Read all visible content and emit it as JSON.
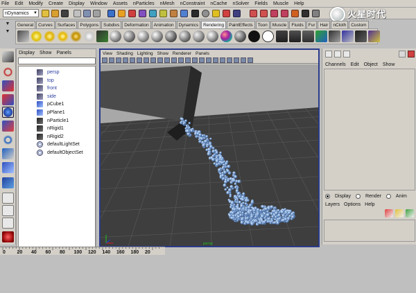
{
  "menus": [
    "File",
    "Edit",
    "Modify",
    "Create",
    "Display",
    "Window",
    "Assets",
    "nParticles",
    "nMesh",
    "nConstraint",
    "nCache",
    "nSolver",
    "Fields",
    "Muscle",
    "Help"
  ],
  "mode_select": "nDynamics",
  "shelf_tabs": [
    "General",
    "Curves",
    "Surfaces",
    "Polygons",
    "Subdivs",
    "Deformation",
    "Animation",
    "Dynamics",
    "Rendering",
    "PaintEffects",
    "Toon",
    "Muscle",
    "Fluids",
    "Fur",
    "Hair",
    "nCloth",
    "Custom"
  ],
  "active_shelf_tab": "Rendering",
  "outliner": {
    "menu": [
      "Display",
      "Show",
      "Panels"
    ],
    "items": [
      {
        "label": "persp",
        "icon": "camera-icon",
        "type": "camera"
      },
      {
        "label": "top",
        "icon": "camera-icon",
        "type": "camera"
      },
      {
        "label": "front",
        "icon": "camera-icon",
        "type": "camera"
      },
      {
        "label": "side",
        "icon": "camera-icon",
        "type": "camera"
      },
      {
        "label": "pCube1",
        "icon": "polygon-icon",
        "type": "mesh"
      },
      {
        "label": "pPlane1",
        "icon": "polygon-icon",
        "type": "mesh"
      },
      {
        "label": "nParticle1",
        "icon": "particle-icon",
        "type": "node"
      },
      {
        "label": "nRigid1",
        "icon": "rigid-icon",
        "type": "node"
      },
      {
        "label": "nRigid2",
        "icon": "rigid-icon",
        "type": "node"
      },
      {
        "label": "defaultLightSet",
        "icon": "set-icon",
        "type": "set"
      },
      {
        "label": "defaultObjectSet",
        "icon": "set-icon",
        "type": "set"
      }
    ]
  },
  "viewport": {
    "menu": [
      "View",
      "Shading",
      "Lighting",
      "Show",
      "Renderer",
      "Panels"
    ],
    "camera_label": "persp"
  },
  "channel_box": {
    "menu": [
      "Channels",
      "Edit",
      "Object",
      "Show"
    ]
  },
  "layer_editor": {
    "radio": [
      {
        "label": "Display",
        "selected": true
      },
      {
        "label": "Render",
        "selected": false
      },
      {
        "label": "Anim",
        "selected": false
      }
    ],
    "menu": [
      "Layers",
      "Options",
      "Help"
    ]
  },
  "timeline": {
    "ticks": [
      "0",
      "20",
      "40",
      "60",
      "80",
      "100",
      "120",
      "140",
      "160",
      "180",
      "20"
    ]
  },
  "watermark": {
    "text": "火星时代",
    "url": "www.hxsd.com"
  },
  "colors": {
    "panel_bg": "#d4d0c8",
    "viewport_sky": "#a9a9a9",
    "viewport_floor": "#3e3e3e",
    "particle": "#7ea4d6",
    "active_border": "#2a3a8a"
  }
}
